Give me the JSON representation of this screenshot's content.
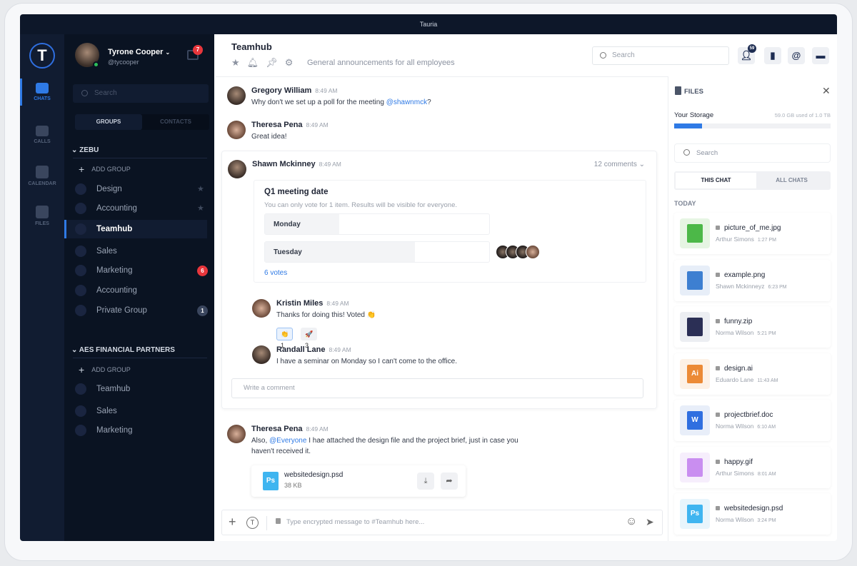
{
  "window": {
    "title": "Tauria"
  },
  "rail": [
    {
      "label": "CHATS",
      "active": true
    },
    {
      "label": "CALLS"
    },
    {
      "label": "CALENDAR"
    },
    {
      "label": "FILES"
    }
  ],
  "logo": "T",
  "user": {
    "name": "Tyrone Cooper",
    "handle": "@tycooper",
    "inbox_count": "7"
  },
  "sidebar": {
    "search_placeholder": "Search",
    "tabs": {
      "groups": "GROUPS",
      "contacts": "CONTACTS"
    },
    "sections": [
      {
        "name": "ZEBU",
        "add": "ADD GROUP",
        "groups": [
          {
            "label": "Design",
            "starred": true
          },
          {
            "label": "Accounting",
            "starred": true
          },
          {
            "label": "Teamhub",
            "active": true
          },
          {
            "label": "Sales"
          },
          {
            "label": "Marketing",
            "count": "6",
            "count_color": "#e8363c"
          },
          {
            "label": "Accounting"
          },
          {
            "label": "Private Group",
            "count": "1",
            "count_color": "#3a465e"
          }
        ]
      },
      {
        "name": "AES FINANCIAL PARTNERS",
        "add": "ADD GROUP",
        "groups": [
          {
            "label": "Teamhub"
          },
          {
            "label": "Sales"
          },
          {
            "label": "Marketing"
          }
        ]
      }
    ]
  },
  "header": {
    "title": "Teamhub",
    "description": "General announcements for all employees",
    "search_placeholder": "Search",
    "contacts_count": "59"
  },
  "messages": [
    {
      "name": "Gregory William",
      "time": "8:49 AM",
      "text": "Why don't we set up a poll for the meeting ",
      "mention": "@shawnmck",
      "suffix": "?"
    },
    {
      "name": "Theresa Pena",
      "time": "8:49 AM",
      "text": "Great idea!"
    },
    {
      "name": "Shawn Mckinney",
      "time": "8:49 AM",
      "comments": "12 comments"
    },
    {
      "name": "Theresa Pena",
      "time": "8:49 AM",
      "text_pre": "Also, ",
      "mention": "@Everyone",
      "text": " I hae attached the design file and the project brief, just in case you",
      "text2": "haven't received it."
    }
  ],
  "poll": {
    "title": "Q1 meeting date",
    "subtitle": "You can only vote for 1 item. Results will be visible for everyone.",
    "options": [
      {
        "label": "Monday",
        "share": 0.33
      },
      {
        "label": "Tuesday",
        "share": 0.67
      }
    ],
    "votes": "6 votes"
  },
  "replies": [
    {
      "name": "Kristin Miles",
      "time": "8:49 AM",
      "text": "Thanks for doing this! Voted 👏",
      "reactions": [
        {
          "emoji": "👏",
          "count": "1"
        },
        {
          "emoji": "🚀",
          "count": "3"
        }
      ]
    },
    {
      "name": "Randall Lane",
      "time": "8:49 AM",
      "text": "I have a seminar on Monday so I can't come to the office."
    }
  ],
  "comment_placeholder": "Write a comment",
  "attachment": {
    "name": "websitedesign.psd",
    "size": "38 KB",
    "icon": "Ps"
  },
  "composer": {
    "placeholder": "Type encrypted message to #Teamhub here..."
  },
  "files": {
    "title": "FILES",
    "storage_label": "Your Storage",
    "storage_text": "59.0 GB used of 1.0 TB",
    "storage_fraction": 0.18,
    "search_placeholder": "Search",
    "tabs": {
      "this": "THIS CHAT",
      "all": "ALL CHATS"
    },
    "group": "TODAY",
    "items": [
      {
        "name": "picture_of_me.jpg",
        "owner": "Arthur Simons",
        "time": "1:27 PM",
        "icon": "",
        "color": "#4cb848",
        "bg": "#e6f5e3"
      },
      {
        "name": "example.png",
        "owner": "Shawn Mckinneyz",
        "time": "6:23 PM",
        "icon": "",
        "color": "#3d7fd1",
        "bg": "#e7eef8"
      },
      {
        "name": "funny.zip",
        "owner": "Norma Wilson",
        "time": "5:21 PM",
        "icon": "",
        "color": "#2b2f55",
        "bg": "#eceef2"
      },
      {
        "name": "design.ai",
        "owner": "Eduardo Lane",
        "time": "11:43 AM",
        "icon": "Ai",
        "color": "#ec8a36",
        "bg": "#fdf1e6"
      },
      {
        "name": "projectbrief.doc",
        "owner": "Norma Wilson",
        "time": "6:10 AM",
        "icon": "W",
        "color": "#2f6fe0",
        "bg": "#e8eef9"
      },
      {
        "name": "happy.gif",
        "owner": "Arthur Simons",
        "time": "8:01 AM",
        "icon": "",
        "color": "#c98ef0",
        "bg": "#f6eefc"
      },
      {
        "name": "websitedesign.psd",
        "owner": "Norma Wilson",
        "time": "3:24 PM",
        "icon": "Ps",
        "color": "#3fb5f0",
        "bg": "#e8f5fc"
      }
    ]
  }
}
